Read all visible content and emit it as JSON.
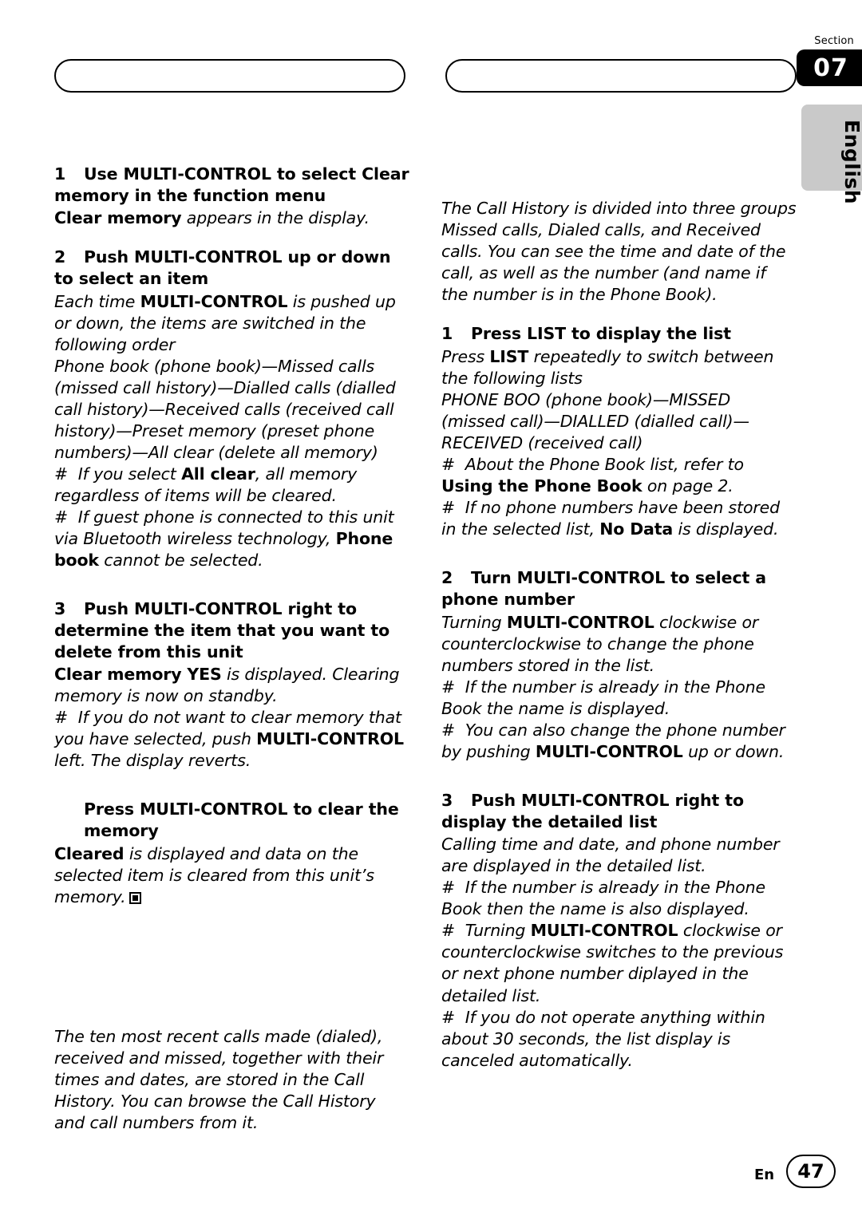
{
  "section": {
    "label": "Section",
    "number": "07"
  },
  "language_tab": "English",
  "footer": {
    "en_label": "En",
    "page_number": "47"
  },
  "left_column": {
    "step1": {
      "num": "1",
      "title": "Use MULTI-CONTROL to select Clear memory in the function menu",
      "body_bold": "Clear memory",
      "body_rest": " appears in the display."
    },
    "step2": {
      "num": "2",
      "title": "Push MULTI-CONTROL up or down to select an item",
      "p1_a": "Each time ",
      "p1_b": "MULTI-CONTROL",
      "p1_c": " is pushed up or down, the items are switched in the following order",
      "items_line": "Phone book (phone book)—Missed calls (missed call history)—Dialled calls (dialled call history)—Received calls (received call history)—Preset memory (preset phone numbers)—All clear (delete all memory)",
      "note1_a": "If you select ",
      "note1_b": "All clear",
      "note1_c": ", all memory regardless of items will be cleared.",
      "note2_a": "If guest phone is connected to this unit via Bluetooth wireless technology, ",
      "note2_b": "Phone book",
      "note2_c": " cannot be selected."
    },
    "step3": {
      "num": "3",
      "title": "Push MULTI-CONTROL right to determine the item that you want to delete from this unit",
      "p1_bold": "Clear memory YES",
      "p1_rest": " is displayed. Clearing memory is now on standby.",
      "note1_a": "If you do not want to clear memory that you have selected, push ",
      "note1_b": "MULTI-CONTROL",
      "note1_c": " left. The display reverts."
    },
    "step4": {
      "title": "Press MULTI-CONTROL to clear the memory",
      "p1_bold": "Cleared",
      "p1_rest": " is displayed and data on the selected item is cleared from this unit’s memory."
    },
    "intro": "The ten most recent calls made (dialed), received and missed, together with their times and dates, are stored in the Call History. You can browse the Call History and call numbers from it."
  },
  "right_column": {
    "intro": "The Call History is divided into three groups Missed calls, Dialed calls, and Received calls. You can see the time and date of the call, as well as the number (and name if the number is in the Phone Book).",
    "step1": {
      "num": "1",
      "title": "Press LIST to display the list",
      "p1_a": "Press ",
      "p1_b": "LIST",
      "p1_c": " repeatedly to switch between the following lists",
      "lists_line": "PHONE BOO (phone book)—MISSED (missed call)—DIALLED (dialled call)—RECEIVED (received call)",
      "note1_a": "About the Phone Book list, refer to ",
      "note1_b": "Using the Phone Book",
      "note1_c": " on page  2.",
      "note2_a": "If no phone numbers have been stored in the selected list, ",
      "note2_b": "No Data",
      "note2_c": " is displayed."
    },
    "step2": {
      "num": "2",
      "title": "Turn MULTI-CONTROL to select a phone number",
      "p1_a": "Turning ",
      "p1_b": "MULTI-CONTROL",
      "p1_c": " clockwise or counterclockwise to change the phone numbers stored in the list.",
      "note1": "If the number is already in the Phone Book the name is displayed.",
      "note2_a": "You can also change the phone number by pushing ",
      "note2_b": "MULTI-CONTROL",
      "note2_c": " up or down."
    },
    "step3": {
      "num": "3",
      "title": "Push MULTI-CONTROL right to display the detailed list",
      "p1": "Calling time and date, and phone number are displayed in the detailed list.",
      "note1": "If the number is already in the Phone Book then the name is also displayed.",
      "note2_a": "Turning ",
      "note2_b": "MULTI-CONTROL",
      "note2_c": " clockwise or counterclockwise switches to the previous or next phone number diplayed in the detailed list.",
      "note3": "If you do not operate anything within about 30 seconds, the list display is canceled automatically."
    }
  }
}
